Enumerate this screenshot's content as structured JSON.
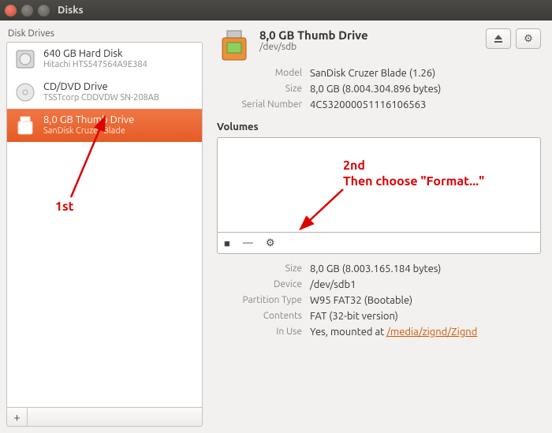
{
  "window": {
    "title": "Disks"
  },
  "sidebar": {
    "label": "Disk Drives",
    "items": [
      {
        "name": "640 GB Hard Disk",
        "sub": "Hitachi HTS547564A9E384"
      },
      {
        "name": "CD/DVD Drive",
        "sub": "TSSTcorp CDDVDW SN-208AB"
      },
      {
        "name": "8,0 GB Thumb Drive",
        "sub": "SanDisk Cruzer Blade"
      }
    ]
  },
  "device": {
    "title": "8,0 GB Thumb Drive",
    "path": "/dev/sdb",
    "labels": {
      "model": "Model",
      "size": "Size",
      "serial": "Serial Number"
    },
    "model": "SanDisk Cruzer Blade (1.26)",
    "size": "8,0 GB (8.004.304.896 bytes)",
    "serial": "4C532000051116106563"
  },
  "volumes": {
    "heading": "Volumes",
    "labels": {
      "size": "Size",
      "device": "Device",
      "ptype": "Partition Type",
      "contents": "Contents",
      "inuse": "In Use"
    },
    "size": "8,0 GB (8.003.165.184 bytes)",
    "device": "/dev/sdb1",
    "ptype": "W95 FAT32 (Bootable)",
    "contents": "FAT (32-bit version)",
    "inuse_prefix": "Yes, mounted at ",
    "inuse_link": "/media/zignd/Zignd"
  },
  "annotations": {
    "first": "1st",
    "second_a": "2nd",
    "second_b": "Then choose \"Format...\""
  }
}
